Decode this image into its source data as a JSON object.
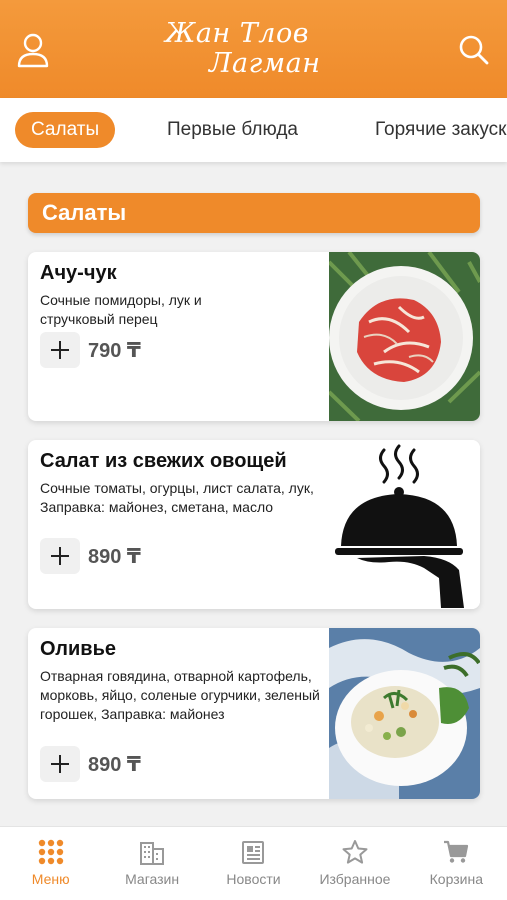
{
  "header": {
    "logo_line1": "Жан Тлов",
    "logo_line2": "Лагман",
    "colors": {
      "brand": "#ef8a2a",
      "brand_light": "#f49a3c"
    },
    "left_icon": "user-icon",
    "right_icon": "search-icon"
  },
  "tabs": [
    {
      "label": "Салаты",
      "active": true
    },
    {
      "label": "Первые блюда",
      "active": false
    },
    {
      "label": "Горячие закуски",
      "active": false
    }
  ],
  "section": {
    "title": "Салаты"
  },
  "products": [
    {
      "title": "Ачу-чук",
      "description": "Сочные помидоры, лук и стручковый перец",
      "price": "790 ₸"
    },
    {
      "title": "Салат из свежих овощей",
      "description": "Сочные томаты, огурцы, лист салата, лук, Заправка: майонез, сметана, масло",
      "price": "890 ₸"
    },
    {
      "title": "Оливье",
      "description": "Отварная говядина, отварной картофель, морковь, яйцо, соленые огурчики, зеленый горошек, Заправка: майонез",
      "price": "890 ₸"
    }
  ],
  "bottom_nav": [
    {
      "label": "Меню",
      "icon": "grid-icon",
      "active": true
    },
    {
      "label": "Магазин",
      "icon": "building-icon",
      "active": false
    },
    {
      "label": "Новости",
      "icon": "newspaper-icon",
      "active": false
    },
    {
      "label": "Избранное",
      "icon": "star-icon",
      "active": false
    },
    {
      "label": "Корзина",
      "icon": "cart-icon",
      "active": false
    }
  ]
}
